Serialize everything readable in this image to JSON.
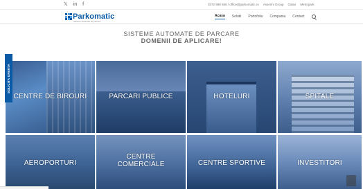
{
  "topbar": {
    "social": [
      "𝕏",
      "in",
      "f"
    ],
    "contact": [
      "0372 988 666 / office@parkomatic.ro",
      "Asserini Group",
      "Galax",
      "Metropark"
    ]
  },
  "header": {
    "logo_text": "Parkomatic",
    "logo_tagline": "Sisteme automate de parcare",
    "nav": [
      "Acasa",
      "Solutii",
      "Portofoliu",
      "Compania",
      "Contact"
    ]
  },
  "hero": {
    "line1": "SISTEME AUTOMATE DE PARCARE",
    "line2": "DOMENII DE APLICARE!"
  },
  "side_tab": "SOLICITA OFERTA",
  "tiles": [
    {
      "label": "CENTRE DE BIROURI"
    },
    {
      "label": "PARCARI PUBLICE"
    },
    {
      "label": "HOTELURI"
    },
    {
      "label": "SPITALE"
    },
    {
      "label": "AEROPORTURI"
    },
    {
      "label": "CENTRE COMERCIALE"
    },
    {
      "label": "CENTRE SPORTIVE"
    },
    {
      "label": "INVESTITORI"
    }
  ],
  "colors": {
    "brand": "#0b5aa6",
    "tile_overlay": "#2f5a93"
  }
}
